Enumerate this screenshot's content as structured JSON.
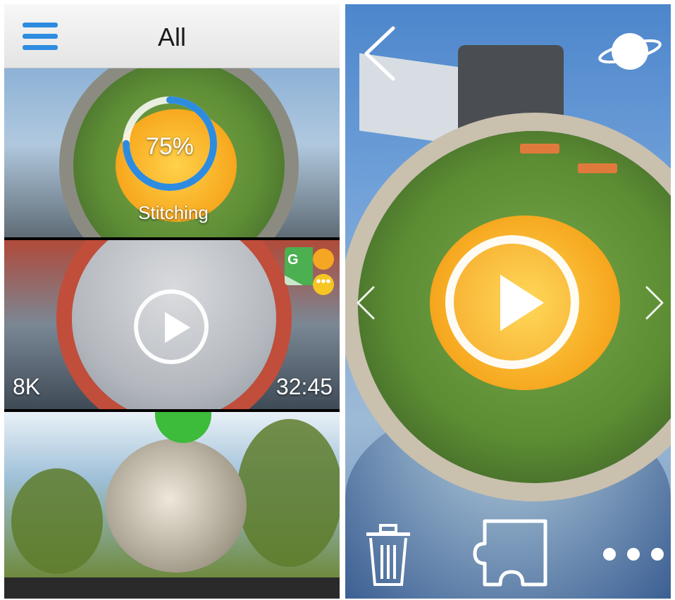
{
  "gallery": {
    "title": "All",
    "items": [
      {
        "progress_percent": 75,
        "progress_label": "75%",
        "status": "Stitching"
      },
      {
        "resolution": "8K",
        "duration": "32:45"
      },
      {}
    ]
  },
  "viewer": {},
  "icons": {
    "menu": "hamburger-menu-icon",
    "play": "play-icon",
    "back": "chevron-left-icon",
    "view_mode": "planet-orbit-icon",
    "prev": "chevron-left-icon",
    "next": "chevron-right-icon",
    "delete": "trash-icon",
    "share": "puzzle-icon",
    "more": "more-dots-icon",
    "google": "google-street-view-icon"
  },
  "colors": {
    "accent": "#2d8ce0",
    "progress_track": "#ffffff",
    "badge": "#f5a623"
  }
}
